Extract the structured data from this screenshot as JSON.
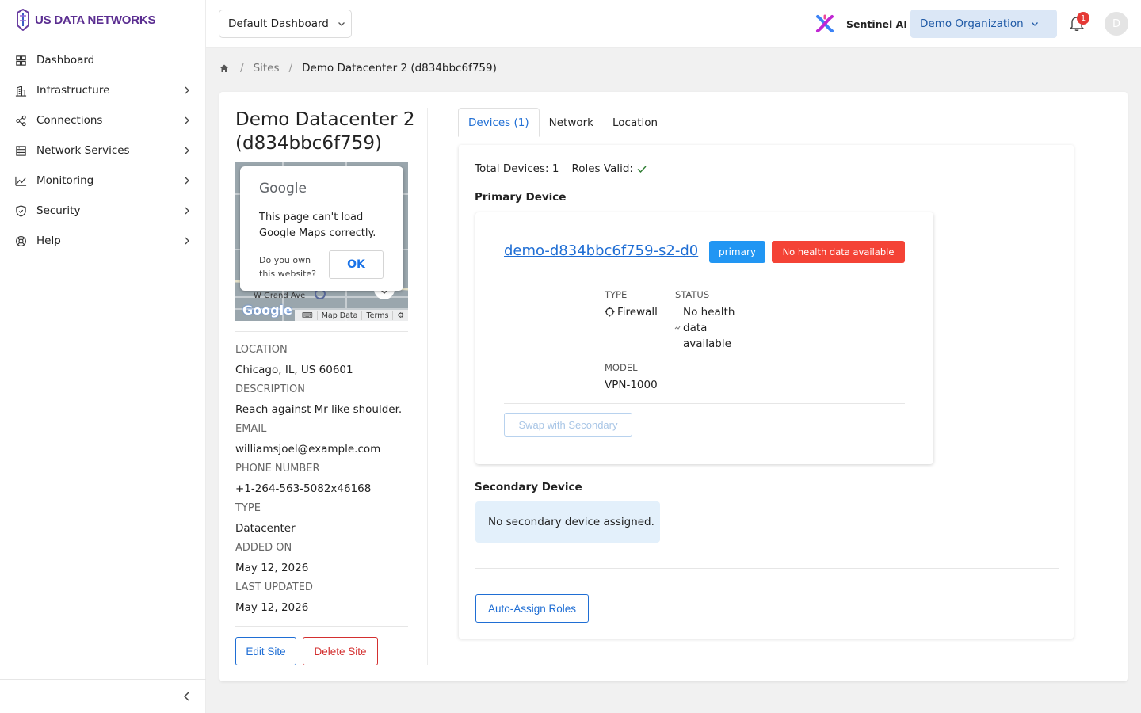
{
  "brand": {
    "name": "US DATA NETWORKS"
  },
  "sidebar": {
    "items": [
      {
        "label": "Dashboard",
        "icon": "grid-icon"
      },
      {
        "label": "Infrastructure",
        "icon": "building-icon"
      },
      {
        "label": "Connections",
        "icon": "share-icon"
      },
      {
        "label": "Network Services",
        "icon": "server-icon"
      },
      {
        "label": "Monitoring",
        "icon": "chart-line-icon"
      },
      {
        "label": "Security",
        "icon": "shield-icon"
      },
      {
        "label": "Help",
        "icon": "lifebuoy-icon"
      }
    ]
  },
  "header": {
    "dashboard_select": "Default Dashboard",
    "assistant_label": "Sentinel AI",
    "org_select": "Demo Organization",
    "notification_count": "1",
    "avatar_initial": "D"
  },
  "breadcrumb": {
    "parent": "Sites",
    "current": "Demo Datacenter 2 (d834bbc6f759)",
    "sep": "/"
  },
  "site": {
    "title": "Demo Datacenter 2 (d834bbc6f759)",
    "map": {
      "brand": "Google",
      "message": "This page can't load Google Maps correctly.",
      "own_question": "Do you own this website?",
      "ok_label": "OK",
      "street": "W Grand Ave",
      "logo": "Google",
      "map_data": "Map Data",
      "terms": "Terms"
    },
    "fields": {
      "location_label": "LOCATION",
      "location": "Chicago, IL, US 60601",
      "description_label": "DESCRIPTION",
      "description": "Reach against Mr like shoulder.",
      "email_label": "EMAIL",
      "email": "williamsjoel@example.com",
      "phone_label": "PHONE NUMBER",
      "phone": "+1-264-563-5082x46168",
      "type_label": "TYPE",
      "type": "Datacenter",
      "added_label": "ADDED ON",
      "added": "May 12, 2026",
      "updated_label": "LAST UPDATED",
      "updated": "May 12, 2026"
    },
    "edit_label": "Edit Site",
    "delete_label": "Delete Site"
  },
  "tabs": [
    {
      "label": "Devices (1)",
      "active": true
    },
    {
      "label": "Network",
      "active": false
    },
    {
      "label": "Location",
      "active": false
    }
  ],
  "devices": {
    "total": "Total Devices: 1",
    "roles_valid": "Roles Valid:",
    "primary_title": "Primary Device",
    "primary": {
      "name": "demo-d834bbc6f759-s2-d0",
      "role_badge": "primary",
      "health_badge": "No health data available",
      "type_label": "TYPE",
      "type": "Firewall",
      "status_label": "STATUS",
      "status_lines": [
        "No health",
        "data",
        "available"
      ],
      "model_label": "MODEL",
      "model": "VPN-1000",
      "swap_label": "Swap with Secondary"
    },
    "secondary_title": "Secondary Device",
    "secondary_empty": "No secondary device assigned.",
    "auto_assign_label": "Auto-Assign Roles"
  },
  "colors": {
    "brand": "#5b2e91",
    "accent": "#1f6ed4",
    "primary_badge": "#2196f3",
    "danger": "#f44336",
    "info_bg": "#e3f0fb"
  }
}
